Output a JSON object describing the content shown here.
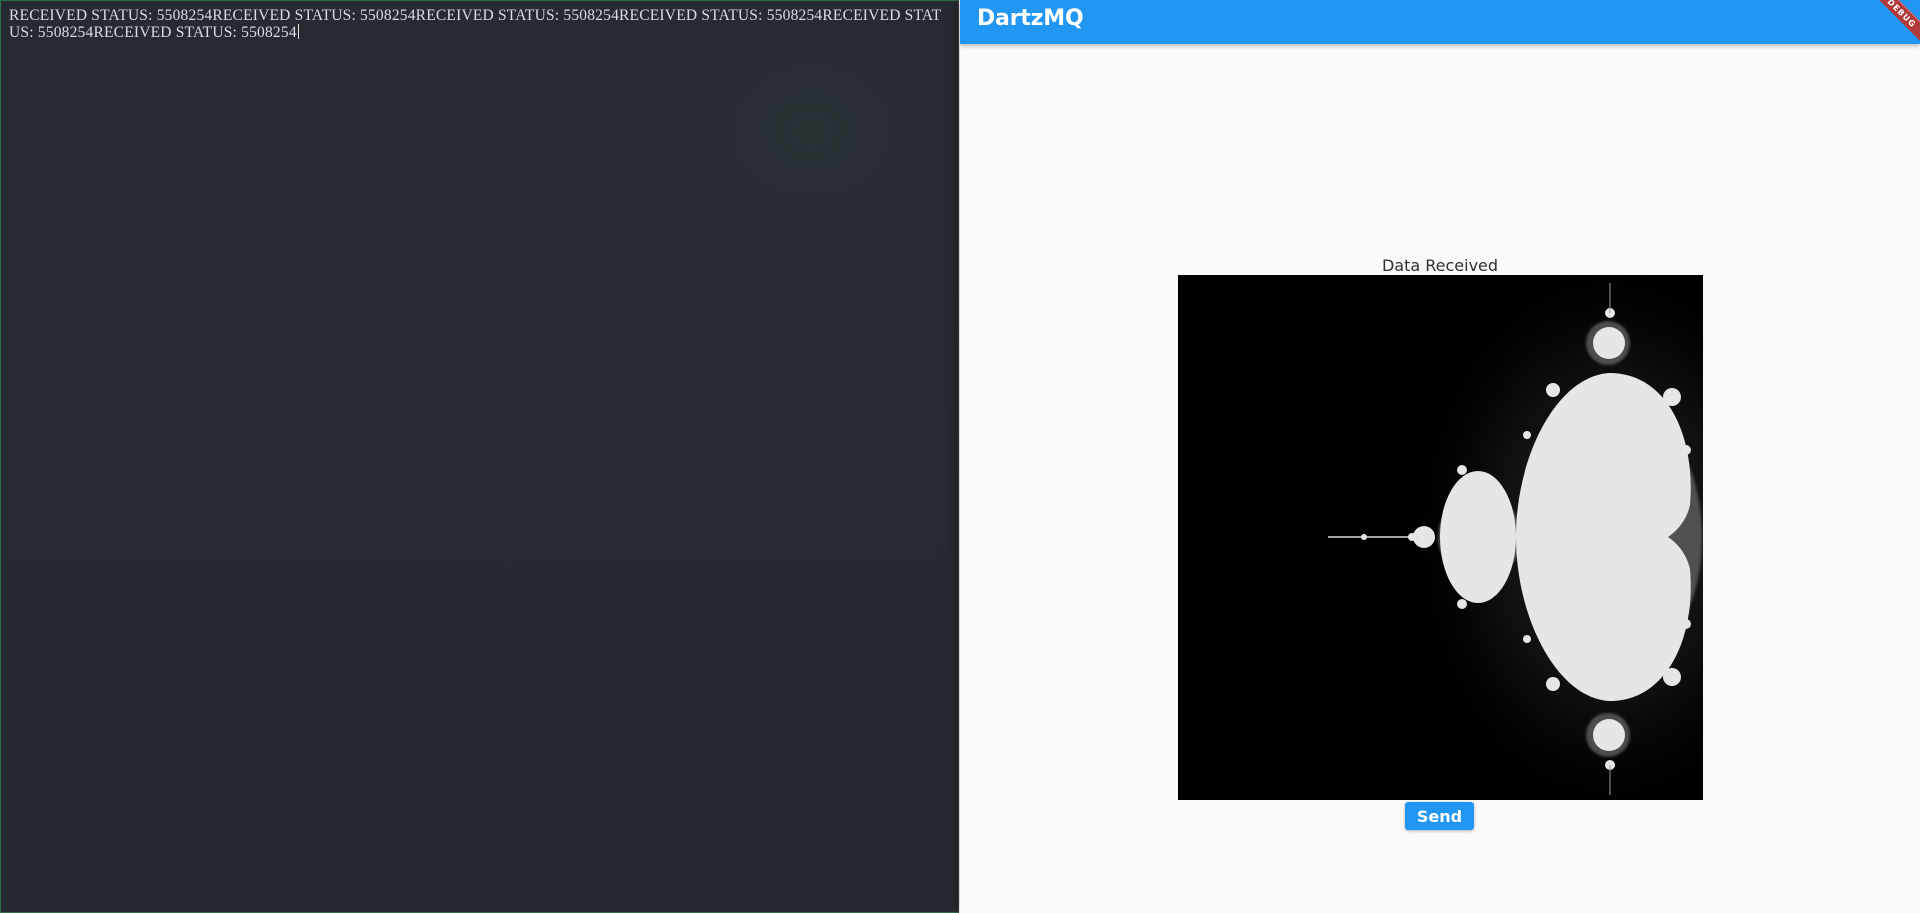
{
  "terminal": {
    "output_text": "RECEIVED STATUS: 5508254RECEIVED STATUS: 5508254RECEIVED STATUS: 5508254RECEIVED STATUS: 5508254RECEIVED STATUS: 5508254RECEIVED STATUS: 5508254"
  },
  "app": {
    "title": "DartzMQ",
    "debug_banner": "DEBUG",
    "data_label": "Data Received",
    "send_label": "Send"
  },
  "colors": {
    "appbar": "#2196f3",
    "terminal_bg": "#262b32",
    "fractal_fill": "#e6e6e6"
  }
}
